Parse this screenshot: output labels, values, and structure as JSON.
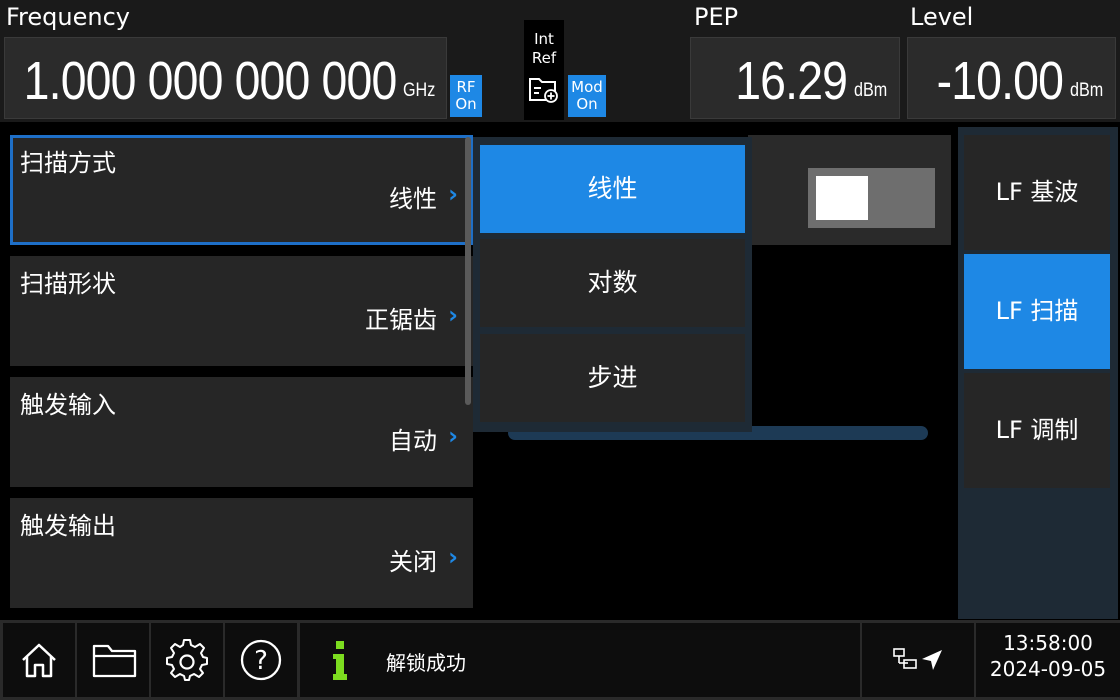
{
  "header": {
    "frequency_label": "Frequency",
    "frequency_value": "1.000 000 000 000",
    "frequency_unit": "GHz",
    "rf_badge_line1": "RF",
    "rf_badge_line2": "On",
    "ref_line1": "Int",
    "ref_line2": "Ref",
    "mod_badge_line1": "Mod",
    "mod_badge_line2": "On",
    "pep_label": "PEP",
    "pep_value": "16.29",
    "pep_unit": "dBm",
    "level_label": "Level",
    "level_value": "-10.00",
    "level_unit": "dBm"
  },
  "menu": {
    "items": [
      {
        "label": "扫描方式",
        "value": "线性"
      },
      {
        "label": "扫描形状",
        "value": "正锯齿"
      },
      {
        "label": "触发输入",
        "value": "自动"
      },
      {
        "label": "触发输出",
        "value": "关闭"
      }
    ]
  },
  "dropdown": {
    "options": [
      "线性",
      "对数",
      "步进"
    ],
    "selected": "线性"
  },
  "side_tabs": {
    "items": [
      "LF 基波",
      "LF 扫描",
      "LF 调制"
    ],
    "selected": "LF 扫描"
  },
  "footer": {
    "icons": [
      "home-icon",
      "folder-icon",
      "gear-icon",
      "help-icon"
    ],
    "status_text": "解锁成功",
    "time": "13:58:00",
    "date": "2024-09-05"
  },
  "colors": {
    "accent": "#1e88e5",
    "info_green": "#7cdc1f",
    "background": "#000000",
    "panel": "#262626"
  }
}
